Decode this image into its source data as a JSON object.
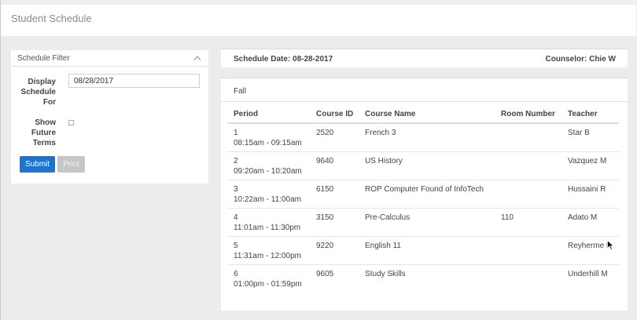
{
  "page": {
    "title": "Student Schedule"
  },
  "filter": {
    "title": "Schedule Filter",
    "display_label": [
      "Display",
      "Schedule",
      "For"
    ],
    "date_value": "08/28/2017",
    "future_label": [
      "Show",
      "Future",
      "Terms"
    ],
    "future_checked": false,
    "submit_label": "Submit",
    "print_label": "Print"
  },
  "info": {
    "schedule_date": "Schedule Date: 08-28-2017",
    "counselor": "Counselor: Chie W"
  },
  "schedule": {
    "term": "Fall",
    "columns": [
      "Period",
      "Course ID",
      "Course Name",
      "Room Number",
      "Teacher"
    ],
    "rows": [
      {
        "period": "1",
        "time": "08:15am - 09:15am",
        "course_id": "2520",
        "course_name": "French 3",
        "room": "",
        "teacher": "Star B"
      },
      {
        "period": "2",
        "time": "09:20am - 10:20am",
        "course_id": "9640",
        "course_name": "US History",
        "room": "",
        "teacher": "Vazquez M"
      },
      {
        "period": "3",
        "time": "10:22am - 11:00am",
        "course_id": "6150",
        "course_name": "ROP Computer Found of InfoTech",
        "room": "",
        "teacher": "Hussaini R"
      },
      {
        "period": "4",
        "time": "11:01am - 11:30pm",
        "course_id": "3150",
        "course_name": "Pre-Calculus",
        "room": "110",
        "teacher": "Adato M"
      },
      {
        "period": "5",
        "time": "11:31am - 12:00pm",
        "course_id": "9220",
        "course_name": "English 11",
        "room": "",
        "teacher": "Reyherme P"
      },
      {
        "period": "6",
        "time": "01:00pm - 01:59pm",
        "course_id": "9605",
        "course_name": "Study Skills",
        "room": "",
        "teacher": "Underhill M"
      }
    ]
  },
  "colors": {
    "accent": "#1a74d0",
    "disabled": "#c6c6c6",
    "background": "#ececec"
  }
}
